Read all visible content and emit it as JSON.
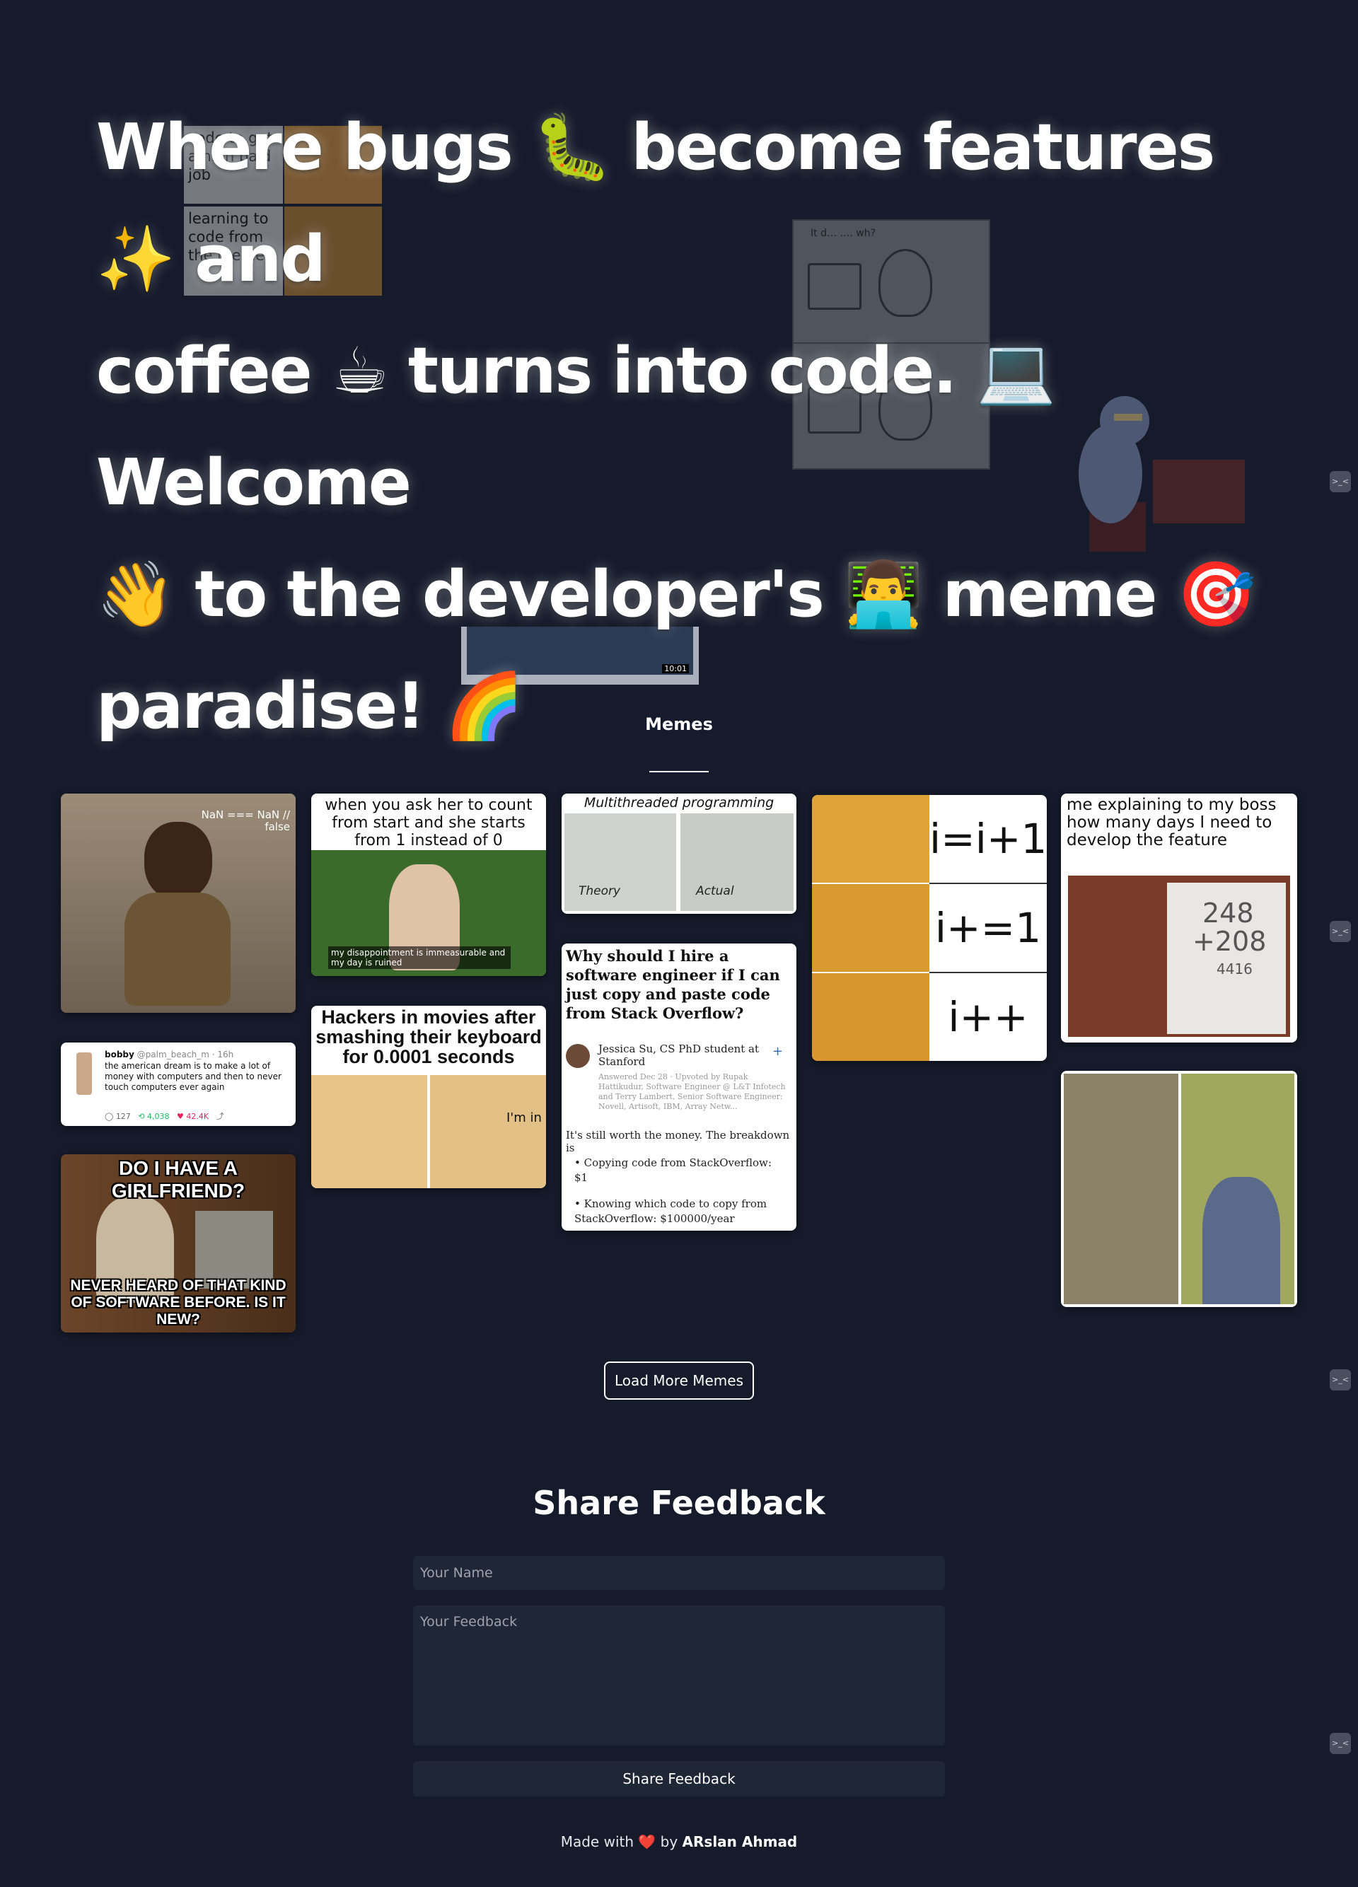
{
  "hero": {
    "line1": "Where bugs 🐛 become features ✨ and",
    "line2": "coffee ☕ turns into code. 💻 Welcome",
    "line3": "👋 to the developer's 👨‍💻 meme 🎯",
    "line4": "paradise! 🌈"
  },
  "floating": {
    "f1_caption_top": "code to get a high paid job",
    "f1_caption_bottom": "learning to code from the memes",
    "f2_caption": "It d… …. wh?",
    "video_duration": "10:01"
  },
  "memes_section": {
    "title": "Memes"
  },
  "memes": {
    "nan": {
      "caption": "NaN === NaN // false"
    },
    "count": {
      "caption": "when you ask her to count from start and she  starts from 1 instead of 0",
      "subtitle": "my disappointment is immeasurable and my day is ruined"
    },
    "tweet": {
      "name": "bobby",
      "handle": "@palm_beach_m · 16h",
      "text": "the american dream is to make a lot of money with computers and then to never touch computers ever again",
      "replies": "127",
      "retweets": "4,038",
      "likes": "42.4K"
    },
    "girlfriend": {
      "top": "DO I HAVE A GIRLFRIEND?",
      "bottom": "NEVER HEARD OF THAT KIND OF SOFTWARE BEFORE. IS IT NEW?"
    },
    "hackers": {
      "caption": "Hackers in movies after smashing their keyboard for 0.0001 seconds",
      "label": "I'm in"
    },
    "multithread": {
      "title": "Multithreaded programming",
      "left": "Theory",
      "right": "Actual"
    },
    "quora": {
      "question": "Why should I hire a software engineer if I can just copy and paste code from Stack Overflow?",
      "author": "Jessica Su, CS PhD student at Stanford",
      "meta": "Answered Dec 28 · Upvoted by Rupak Hattikudur, Software Engineer @ L&T Infotech and Terry Lambert, Senior Software Engineer: Novell, Artisoft, IBM, Array Netw...",
      "intro": "It's still worth the money. The breakdown is",
      "bullet1": "Copying code from StackOverflow: $1",
      "bullet2": "Knowing which code to copy from StackOverflow: $100000/year"
    },
    "pooh": {
      "top": "i=i+1",
      "mid": "i+=1",
      "bottom": "i++"
    },
    "boss": {
      "caption": "me explaining to my boss how many days I need to develop the feature",
      "board_top": "248",
      "board_mid": "+208",
      "board_bottom": "4416"
    }
  },
  "load_more": {
    "label": "Load More Memes"
  },
  "feedback": {
    "title": "Share Feedback",
    "name_placeholder": "Your Name",
    "feedback_placeholder": "Your Feedback",
    "submit_label": "Share Feedback"
  },
  "footer": {
    "prefix": "Made with",
    "heart": "❤️",
    "by": "by",
    "author": "ARslan Ahmad"
  },
  "side_icon": {
    "glyph": ">_<"
  },
  "colors": {
    "background": "#151b2b",
    "field": "#1f2636",
    "heart": "#e11d48"
  }
}
